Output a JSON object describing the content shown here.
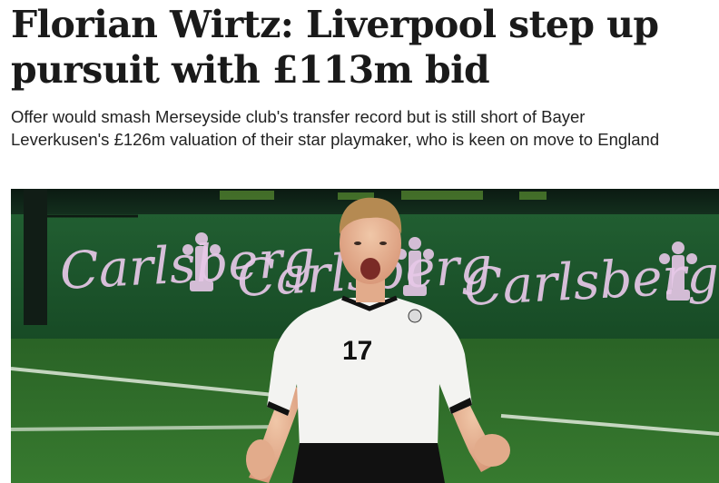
{
  "article": {
    "headline_line1": "Florian Wirtz: Liverpool step up",
    "headline_line2": "pursuit with £113m bid",
    "standfirst_line1": "Offer would smash Merseyside club's transfer record but is still short of Bayer",
    "standfirst_line2": "Leverkusen's £126m valuation of their star playmaker, who is keen on move to England"
  },
  "photo": {
    "sponsor_boards": [
      "Carlsberg",
      "Carlsberg",
      "Carlsberg"
    ],
    "shirt_number": "17",
    "colors": {
      "board_green": "#1f5a2e",
      "pitch_green": "#2f6e2a",
      "sponsor_text": "#e7c8e8",
      "shirt": "#f3f3f1",
      "shorts": "#111111"
    }
  }
}
